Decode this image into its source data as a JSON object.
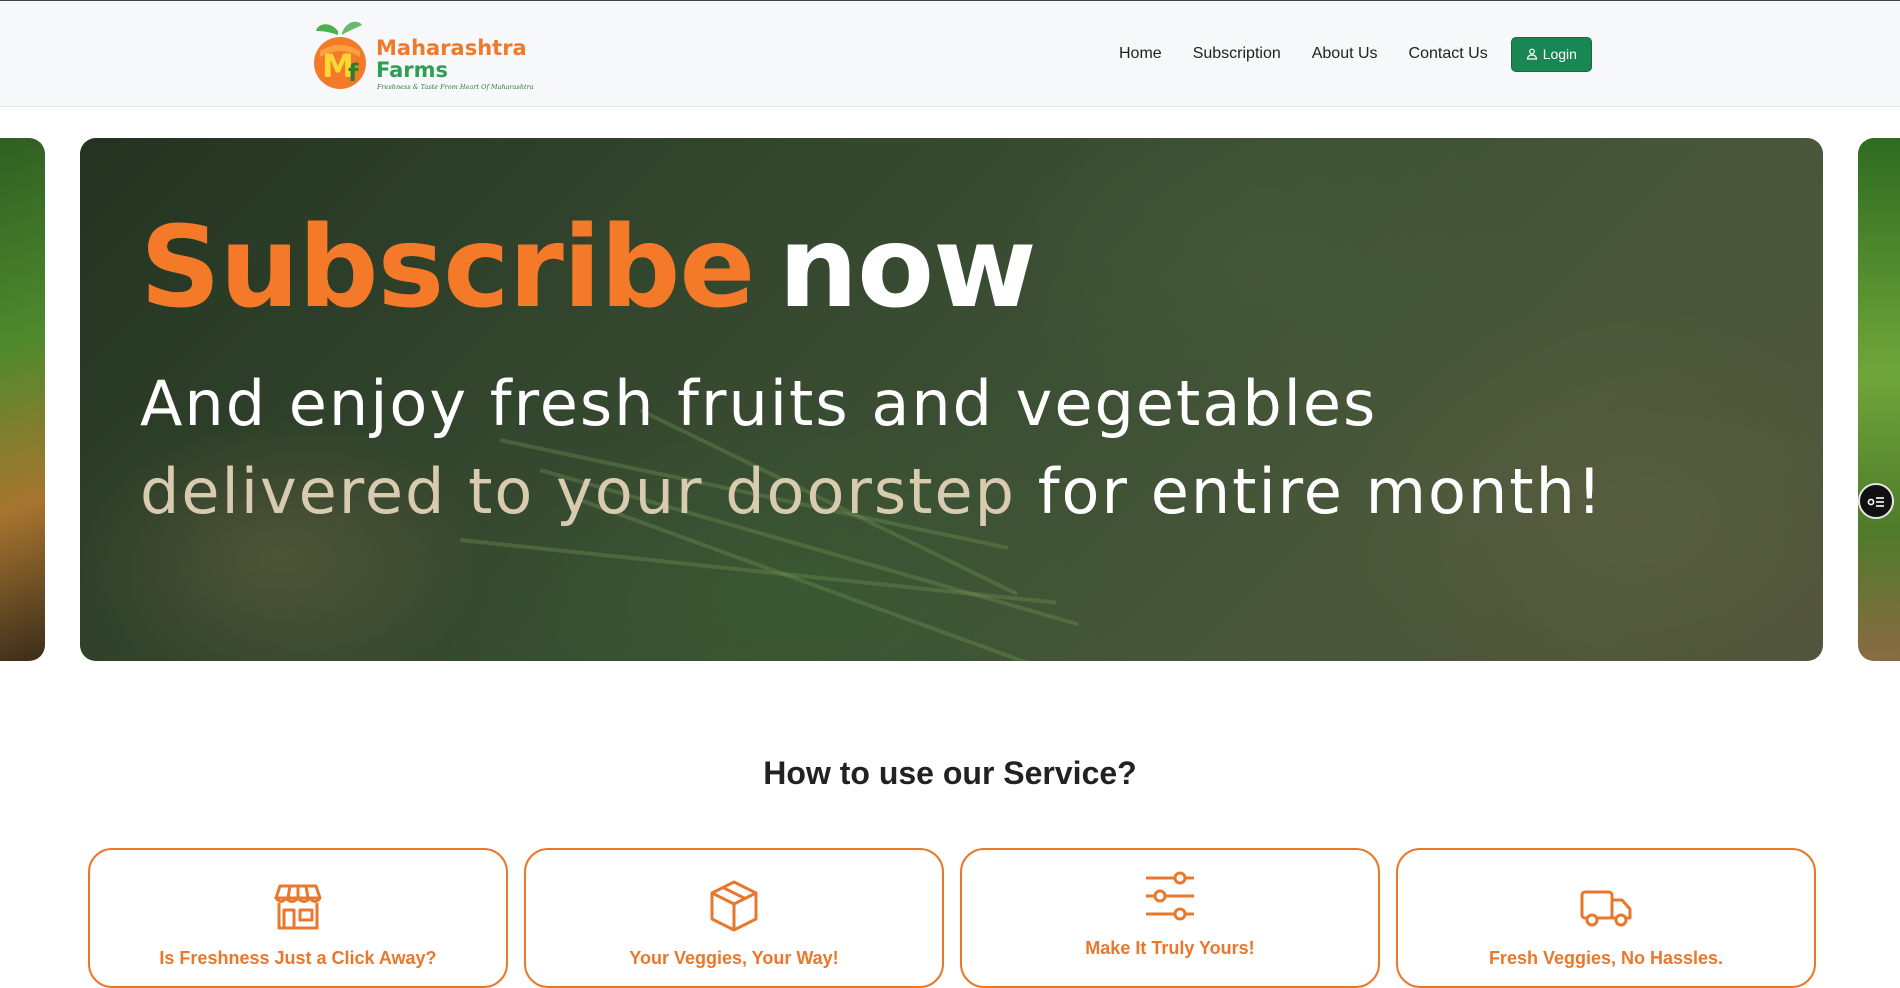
{
  "brand": {
    "name_line1": "Maharashtra",
    "name_line2": "Farms",
    "tagline": "Freshness & Taste From Heart Of Maharashtra",
    "colors": {
      "orange": "#f47a2a",
      "green": "#198754"
    }
  },
  "nav": {
    "items": [
      {
        "label": "Home"
      },
      {
        "label": "Subscription"
      },
      {
        "label": "About Us"
      },
      {
        "label": "Contact Us"
      }
    ],
    "login_label": "Login",
    "login_icon": "user-icon"
  },
  "hero": {
    "headline_accent": "Subscribe",
    "headline_rest": "now",
    "line2": "And enjoy fresh fruits and vegetables",
    "line3_muted": "delivered to your doorstep",
    "line3_rest": "for entire month!"
  },
  "how_to": {
    "title": "How to use our Service?",
    "cards": [
      {
        "title": "Is Freshness Just a Click Away?",
        "icon": "store-icon"
      },
      {
        "title": "Your Veggies, Your Way!",
        "icon": "box-icon"
      },
      {
        "title": "Make It Truly Yours!",
        "icon": "sliders-icon"
      },
      {
        "title": "Fresh Veggies, No Hassles.",
        "icon": "truck-icon"
      }
    ]
  },
  "widgets": {
    "floating_button_icon": "toggle-list-icon"
  }
}
